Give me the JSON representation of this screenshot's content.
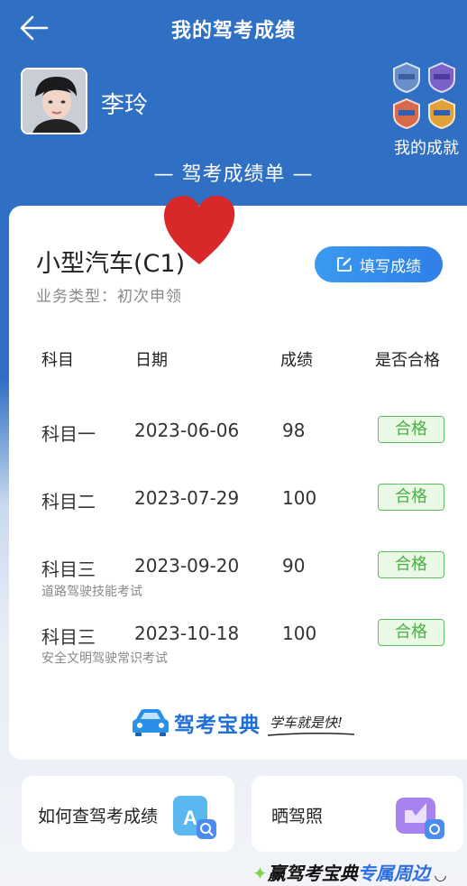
{
  "header": {
    "title": "我的驾考成绩",
    "back_icon": "arrow-left-icon"
  },
  "profile": {
    "name": "李玲",
    "achievements_label": "我的成就"
  },
  "sheet_title": "— 驾考成绩单 —",
  "card": {
    "vehicle_type": "小型汽车(C1)",
    "business_type": "业务类型：初次申领",
    "fill_button_label": "填写成绩",
    "columns": [
      "科目",
      "日期",
      "成绩",
      "是否合格"
    ],
    "rows": [
      {
        "subject": "科目一",
        "date": "2023-06-06",
        "score": "98",
        "result": "合格",
        "note": ""
      },
      {
        "subject": "科目二",
        "date": "2023-07-29",
        "score": "100",
        "result": "合格",
        "note": ""
      },
      {
        "subject": "科目三",
        "date": "2023-09-20",
        "score": "90",
        "result": "合格",
        "note": "道路驾驶技能考试"
      },
      {
        "subject": "科目三",
        "date": "2023-10-18",
        "score": "100",
        "result": "合格",
        "note": "安全文明驾驶常识考试"
      }
    ],
    "brand": {
      "name": "驾考宝典",
      "slogan": "学车就是快!"
    }
  },
  "tiles": [
    {
      "label": "如何查驾考成绩",
      "icon": "search-doc-icon"
    },
    {
      "label": "晒驾照",
      "icon": "photo-share-icon"
    }
  ],
  "promo": {
    "part1": "赢驾考宝典",
    "part2": "专属周边"
  },
  "colors": {
    "header_blue": "#2f6fc4",
    "accent_blue": "#2f7fe8",
    "pass_green": "#49b043",
    "heart_red": "#d8282a"
  }
}
